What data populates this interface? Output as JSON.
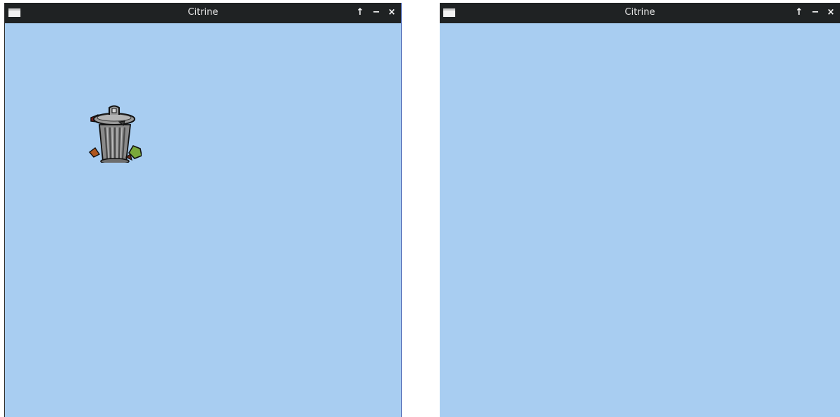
{
  "windows": [
    {
      "title": "Citrine",
      "controls": {
        "maximize": "↑",
        "minimize": "−",
        "close": "×"
      },
      "content": {
        "background": "#a8cdf1",
        "items": [
          {
            "icon": "trash-can-icon"
          }
        ]
      }
    },
    {
      "title": "Citrine",
      "controls": {
        "maximize": "↑",
        "minimize": "−",
        "close": "×"
      },
      "content": {
        "background": "#a8cdf1",
        "items": []
      }
    }
  ],
  "colors": {
    "titlebar": "#1f2223",
    "window_background": "#a8cdf1"
  }
}
